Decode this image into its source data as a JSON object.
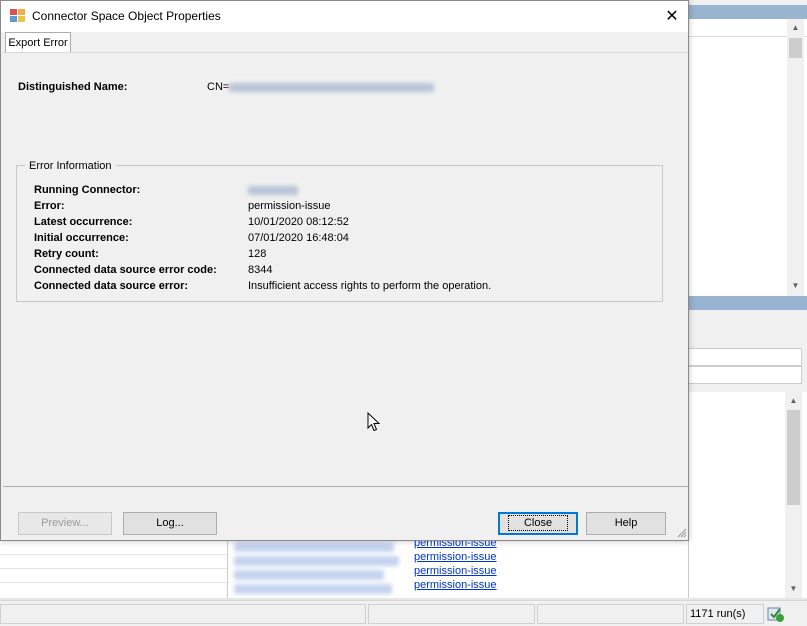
{
  "dialog": {
    "title": "Connector Space Object Properties",
    "close_glyph": "✕",
    "tab_label": "Export Error",
    "distinguished_name_label": "Distinguished Name:",
    "distinguished_name_prefix": "CN=",
    "group_title": "Error Information",
    "error_info": [
      {
        "label": "Running Connector:",
        "value": ""
      },
      {
        "label": "Error:",
        "value": "permission-issue"
      },
      {
        "label": "Latest occurrence:",
        "value": "10/01/2020 08:12:52"
      },
      {
        "label": "Initial occurrence:",
        "value": "07/01/2020 16:48:04"
      },
      {
        "label": "Retry count:",
        "value": "128"
      },
      {
        "label": "Connected data source error code:",
        "value": "8344"
      },
      {
        "label": "Connected data source error:",
        "value": "Insufficient access rights to perform the operation."
      }
    ],
    "buttons": {
      "preview": "Preview...",
      "log": "Log...",
      "close": "Close",
      "help": "Help"
    }
  },
  "background": {
    "error_links": [
      "permission-issue",
      "permission-issue",
      "permission-issue",
      "permission-issue"
    ],
    "status_runs": "1171 run(s)"
  },
  "icons": {
    "title": "app-window-icon",
    "close": "close-icon",
    "status": "sync-status-icon",
    "cursor": "mouse-pointer-icon",
    "grip": "resize-grip-icon"
  },
  "colors": {
    "title_bg": "#ffffff",
    "dialog_bg": "#f0f0f0",
    "header_strip": "#99b4d1",
    "link": "#0033cc",
    "default_button_border": "#0078d7"
  }
}
